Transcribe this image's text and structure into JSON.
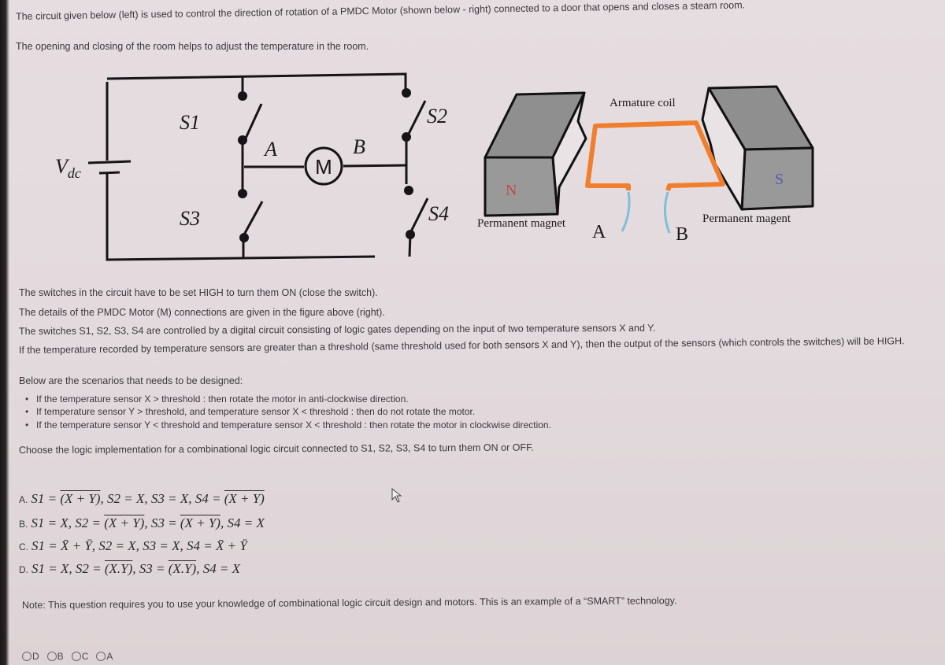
{
  "intro": {
    "line1": "The circuit given below (left) is used to control the direction of rotation of a PMDC Motor (shown below - right) connected to a door that opens and closes a steam room.",
    "line2": "The opening and closing of the room helps to adjust the temperature in the room."
  },
  "circuit": {
    "source_label": "V",
    "source_subscript": "dc",
    "switches": [
      "S1",
      "S2",
      "S3",
      "S4"
    ],
    "motor_label": "M",
    "terminal_a": "A",
    "terminal_b": "B"
  },
  "motor_figure": {
    "coil_label": "Armature coil",
    "north_label": "N",
    "south_label": "S",
    "left_magnet_label": "Permanent magnet",
    "right_magnet_label": "Permanent magent",
    "terminal_a": "A",
    "terminal_b": "B",
    "colors": {
      "coil": "#f07e2c",
      "leads": "#7fbfd8",
      "north": "#c24a4a",
      "south": "#5a5aa8",
      "magnet": "#8e8e8e"
    }
  },
  "body": {
    "p1": "The switches in the circuit have to be set HIGH to turn them ON (close the switch).",
    "p2": "The details of the PMDC Motor (M) connections are given in the figure above (right).",
    "p3": "The switches S1, S2, S3, S4 are controlled by a digital circuit consisting of logic gates depending on the input of two temperature sensors X and Y.",
    "p4": "If the temperature recorded by temperature sensors are greater than a threshold (same threshold used for both sensors X and Y), then the output of the sensors (which controls the switches) will be HIGH.",
    "p5": "Below are the scenarios that needs to be designed:",
    "bullets": [
      "If the temperature sensor X > threshold : then rotate the motor in anti-clockwise direction.",
      "If temperature sensor Y > threshold, and temperature sensor X < threshold : then do not rotate the motor.",
      "If the temperature sensor Y < threshold and temperature sensor X < threshold : then rotate the motor in clockwise direction."
    ],
    "question": "Choose the logic implementation for a combinational logic circuit connected to S1, S2, S3, S4 to turn them ON or OFF."
  },
  "options": [
    {
      "label": "A.",
      "s1": "(X + Y)",
      "s1_bar": true,
      "s2": "X",
      "s3": "X",
      "s4": "(X + Y)",
      "s4_bar": true
    },
    {
      "label": "B.",
      "s1": "X",
      "s2": "(X + Y)",
      "s2_bar": true,
      "s3": "(X + Y)",
      "s3_bar": true,
      "s4": "X"
    },
    {
      "label": "C.",
      "s1": "X̄ + Ȳ",
      "s2": "X",
      "s3": "X",
      "s4": "X̄ + Ȳ"
    },
    {
      "label": "D.",
      "s1": "X",
      "s2": "(X.Y)",
      "s2_bar": true,
      "s3": "(X.Y)",
      "s3_bar": true,
      "s4": "X"
    }
  ],
  "note": "Note: This question requires you to use your knowledge of combinational logic circuit design and motors. This is an example of a “SMART” technology.",
  "answer_choices": [
    "D",
    "B",
    "C",
    "A"
  ]
}
